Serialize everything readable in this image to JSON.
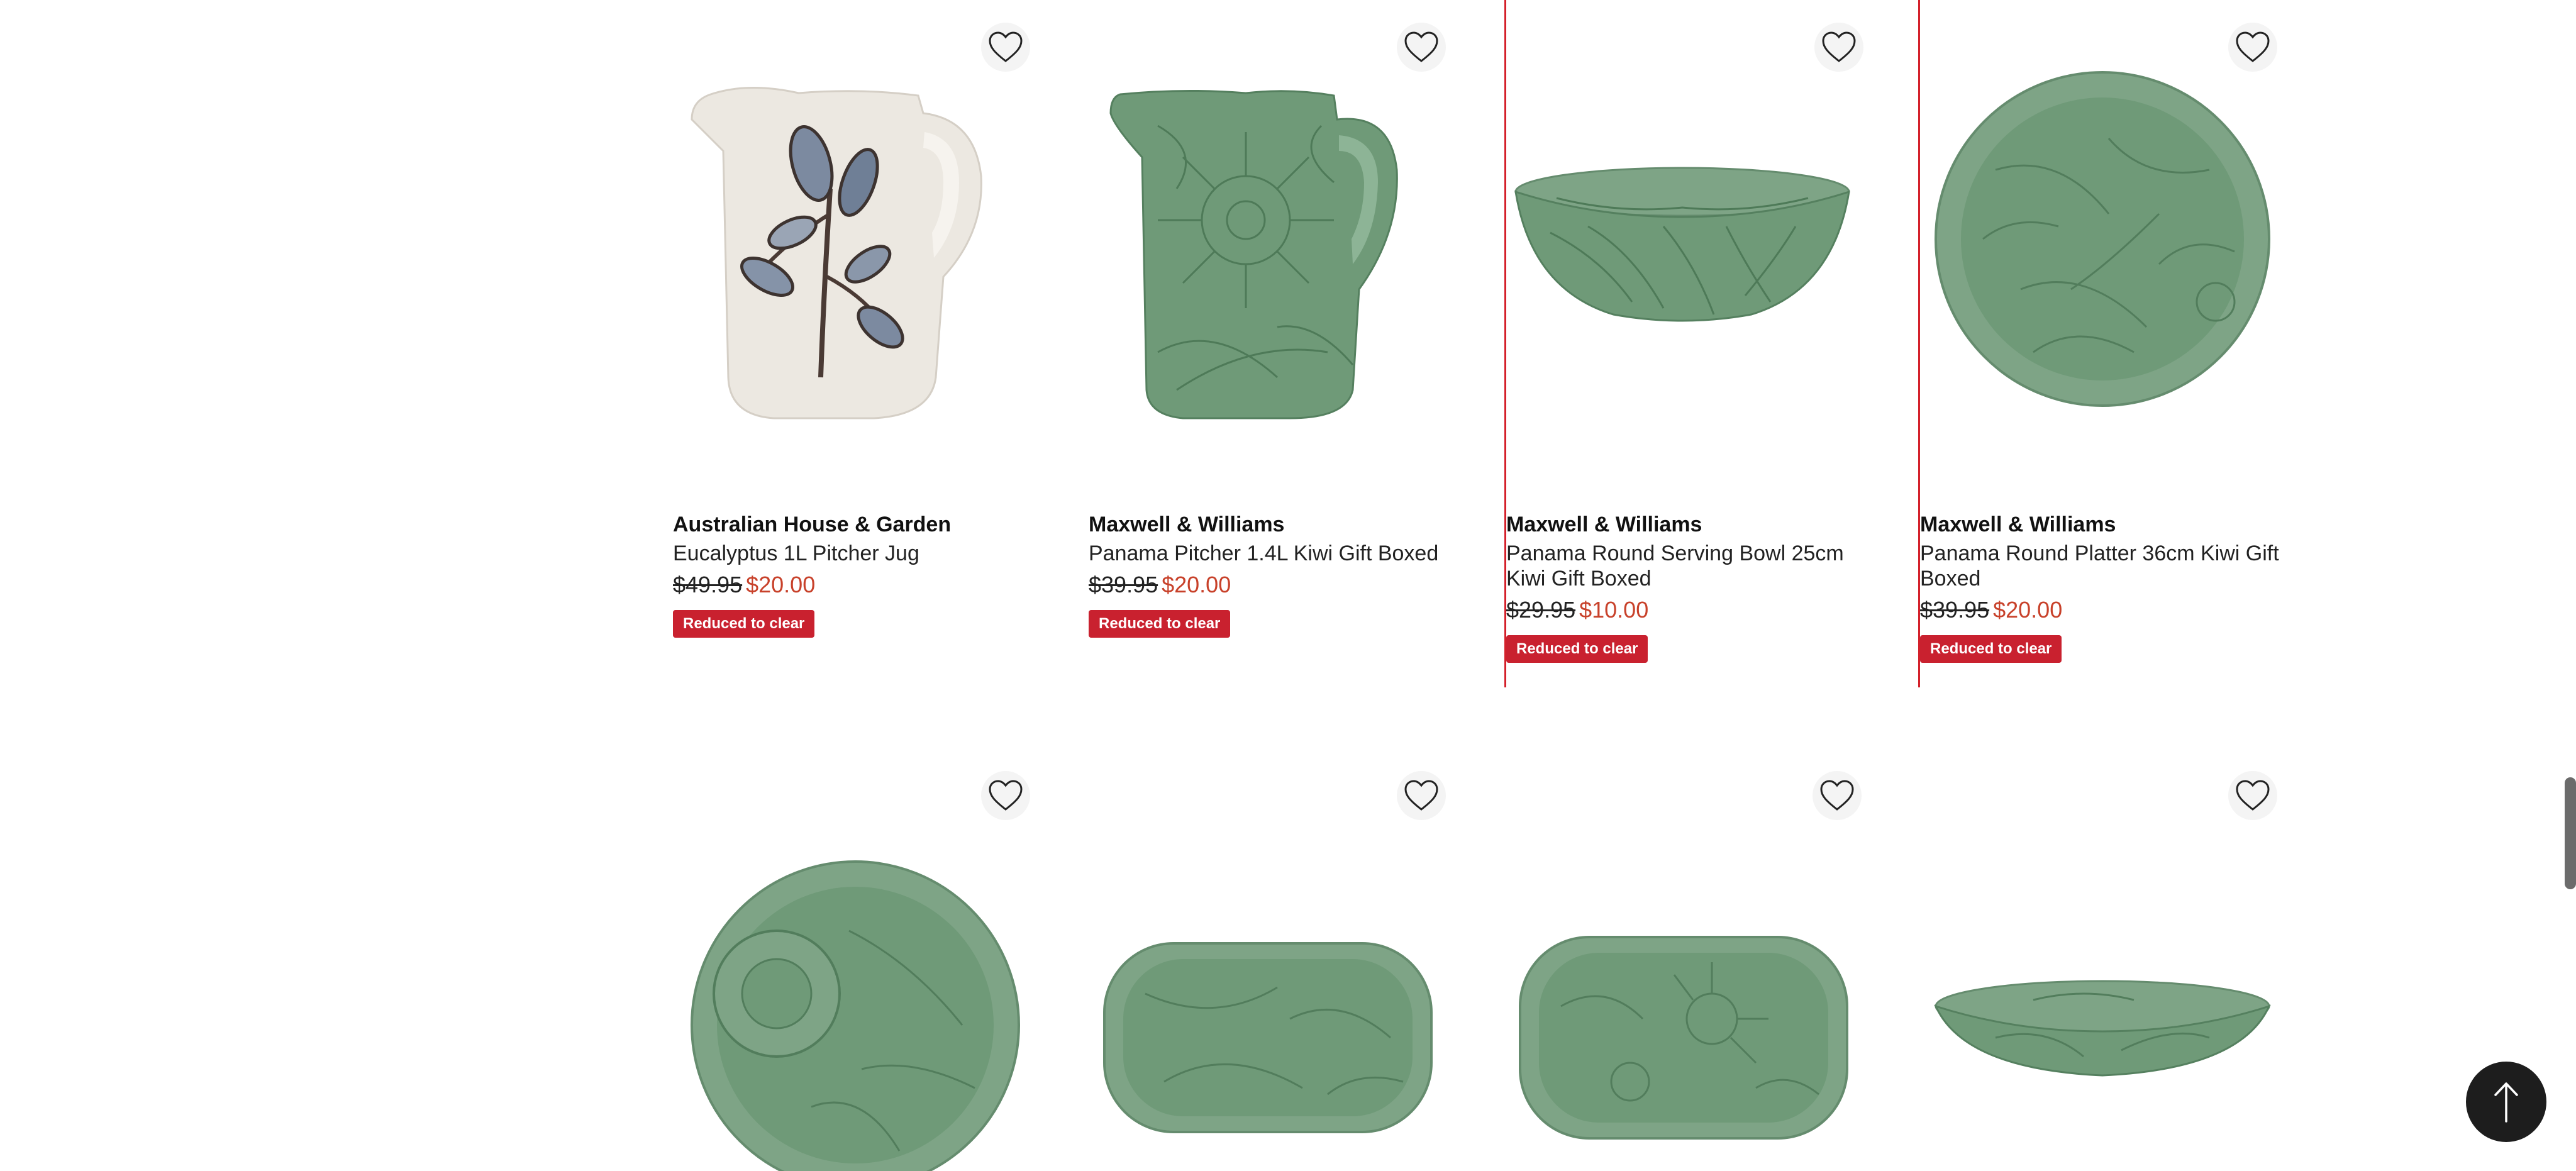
{
  "products_row1": [
    {
      "brand": "Australian House & Garden",
      "title": "Eucalyptus 1L Pitcher Jug",
      "was_price": "$49.95",
      "now_price": "$20.00",
      "badge": "Reduced to clear"
    },
    {
      "brand": "Maxwell & Williams",
      "title": "Panama Pitcher 1.4L Kiwi Gift Boxed",
      "was_price": "$39.95",
      "now_price": "$20.00",
      "badge": "Reduced to clear"
    },
    {
      "brand": "Maxwell & Williams",
      "title": "Panama Round Serving Bowl 25cm Kiwi Gift Boxed",
      "was_price": "$29.95",
      "now_price": "$10.00",
      "badge": "Reduced to clear"
    },
    {
      "brand": "Maxwell & Williams",
      "title": "Panama Round Platter 36cm Kiwi Gift Boxed",
      "was_price": "$39.95",
      "now_price": "$20.00",
      "badge": "Reduced to clear"
    }
  ],
  "colors": {
    "sale_price": "#c8412a",
    "badge_bg": "#c9212f",
    "focus_border": "#d4202a",
    "kiwi_green": "#6f9a78"
  },
  "icons": {
    "wishlist": "heart-outline-icon",
    "back_to_top": "arrow-up-icon"
  }
}
